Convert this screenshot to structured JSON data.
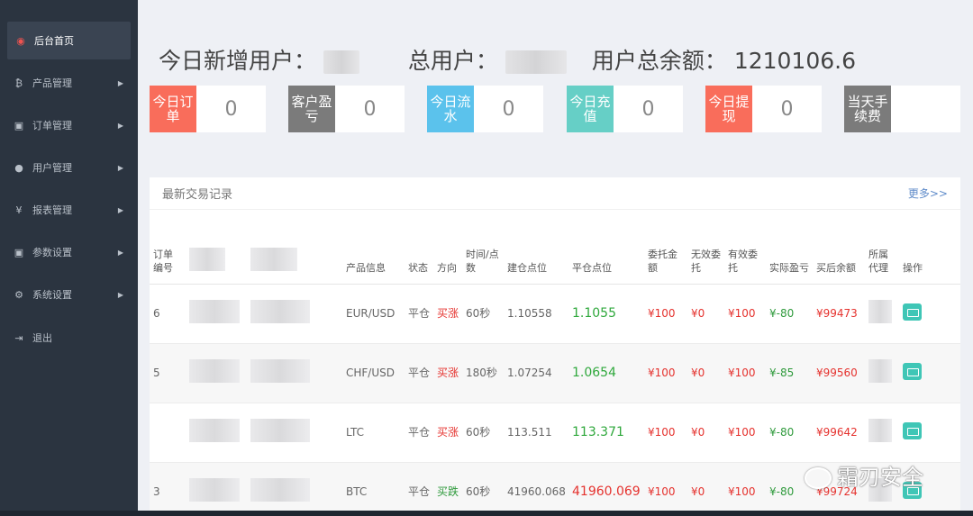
{
  "sidebar": {
    "items": [
      {
        "label": "后台首页",
        "icon": "dashboard-icon",
        "glyph": "◉",
        "active": true
      },
      {
        "label": "产品管理",
        "icon": "bitcoin-icon",
        "glyph": "₿",
        "arrow": "▶"
      },
      {
        "label": "订单管理",
        "icon": "copy-icon",
        "glyph": "▣",
        "arrow": "▶"
      },
      {
        "label": "用户管理",
        "icon": "user-icon",
        "glyph": "●",
        "arrow": "▶"
      },
      {
        "label": "报表管理",
        "icon": "yen-icon",
        "glyph": "¥",
        "arrow": "▶"
      },
      {
        "label": "参数设置",
        "icon": "copy-icon",
        "glyph": "▣",
        "arrow": "▶"
      },
      {
        "label": "系统设置",
        "icon": "gears-icon",
        "glyph": "⚙",
        "arrow": "▶"
      },
      {
        "label": "退出",
        "icon": "signout-icon",
        "glyph": "⇥"
      }
    ]
  },
  "header": {
    "new_users_label": "今日新增用户：",
    "total_users_label": "总用户：",
    "total_balance_label": "用户总余额：",
    "total_balance_value": "1210106.6"
  },
  "stats": [
    {
      "label": "今日订单",
      "value": "0",
      "color": "#f96d5b"
    },
    {
      "label": "客户盈亏",
      "value": "0",
      "color": "#7b7b7b"
    },
    {
      "label": "今日流水",
      "value": "0",
      "color": "#5bc2ec"
    },
    {
      "label": "今日充值",
      "value": "0",
      "color": "#66cfc6"
    },
    {
      "label": "今日提现",
      "value": "0",
      "color": "#f96d5b"
    },
    {
      "label": "当天手续费",
      "value": "",
      "color": "#7b7b7b"
    }
  ],
  "trades": {
    "title": "最新交易记录",
    "more": "更多>>",
    "columns": [
      "订单编号",
      "",
      "",
      "产品信息",
      "状态",
      "方向",
      "时间/点数",
      "建仓点位",
      "平仓点位",
      "委托金额",
      "无效委托",
      "有效委托",
      "实际盈亏",
      "买后余额",
      "所属代理",
      "操作"
    ],
    "rows": [
      {
        "id": "6",
        "product": "EUR/USD",
        "status": "平仓",
        "direction": "买涨",
        "time": "60秒",
        "open": "1.10558",
        "close": "1.1055",
        "close_up": true,
        "amount": "¥100",
        "invalid": "¥0",
        "valid": "¥100",
        "pnl": "¥-80",
        "balance": "¥99473"
      },
      {
        "id": "5",
        "product": "CHF/USD",
        "status": "平仓",
        "direction": "买涨",
        "time": "180秒",
        "open": "1.07254",
        "close": "1.0654",
        "close_up": true,
        "amount": "¥100",
        "invalid": "¥0",
        "valid": "¥100",
        "pnl": "¥-85",
        "balance": "¥99560"
      },
      {
        "id": "",
        "product": "LTC",
        "status": "平仓",
        "direction": "买涨",
        "time": "60秒",
        "open": "113.511",
        "close": "113.371",
        "close_up": true,
        "amount": "¥100",
        "invalid": "¥0",
        "valid": "¥100",
        "pnl": "¥-80",
        "balance": "¥99642"
      },
      {
        "id": "3",
        "product": "BTC",
        "status": "平仓",
        "direction": "买跌",
        "time": "60秒",
        "open": "41960.068",
        "close": "41960.069",
        "close_up": false,
        "amount": "¥100",
        "invalid": "¥0",
        "valid": "¥100",
        "pnl": "¥-80",
        "balance": "¥99724"
      }
    ]
  },
  "watermark": "霜刃安全"
}
